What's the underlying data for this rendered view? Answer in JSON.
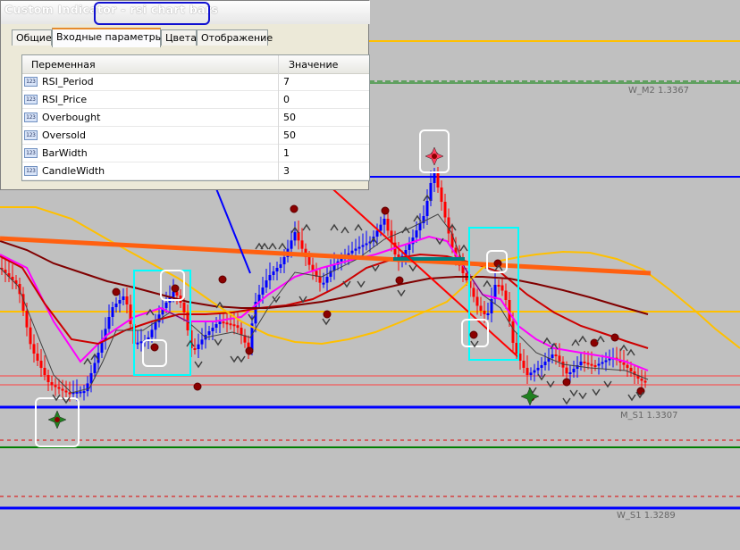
{
  "window": {
    "title": "Custom Indicator - rsi chart bars"
  },
  "tabs": [
    "Общие",
    "Входные параметры",
    "Цвета",
    "Отображение"
  ],
  "active_tab_index": 1,
  "params_table": {
    "columns": [
      "Переменная",
      "Значение"
    ],
    "rows": [
      {
        "icon": "123",
        "name": "RSI_Period",
        "value": "7"
      },
      {
        "icon": "123",
        "name": "RSI_Price",
        "value": "0"
      },
      {
        "icon": "123",
        "name": "Overbought",
        "value": "50"
      },
      {
        "icon": "123",
        "name": "Oversold",
        "value": "50"
      },
      {
        "icon": "123",
        "name": "BarWidth",
        "value": "1"
      },
      {
        "icon": "123",
        "name": "CandleWidth",
        "value": "3"
      }
    ]
  },
  "chart": {
    "background": "#c0c0c0",
    "level_labels": {
      "w_m2": "W_M2 1.3367",
      "m_s1": "M_S1 1.3307",
      "w_s1": "W_S1 1.3289"
    },
    "colors": {
      "bull_bar": "#0000ff",
      "bear_bar": "#ff0000",
      "ma_fast": "#ff00ff",
      "ma_mid": "#cc0000",
      "ma_slow": "#800000",
      "ma_band": "#ffc000",
      "pivot_blue": "#0000ff",
      "arrow_annotation": "#ff0000",
      "trend_line": "#ff6010",
      "highlight_cyan": "#00ffff"
    }
  }
}
